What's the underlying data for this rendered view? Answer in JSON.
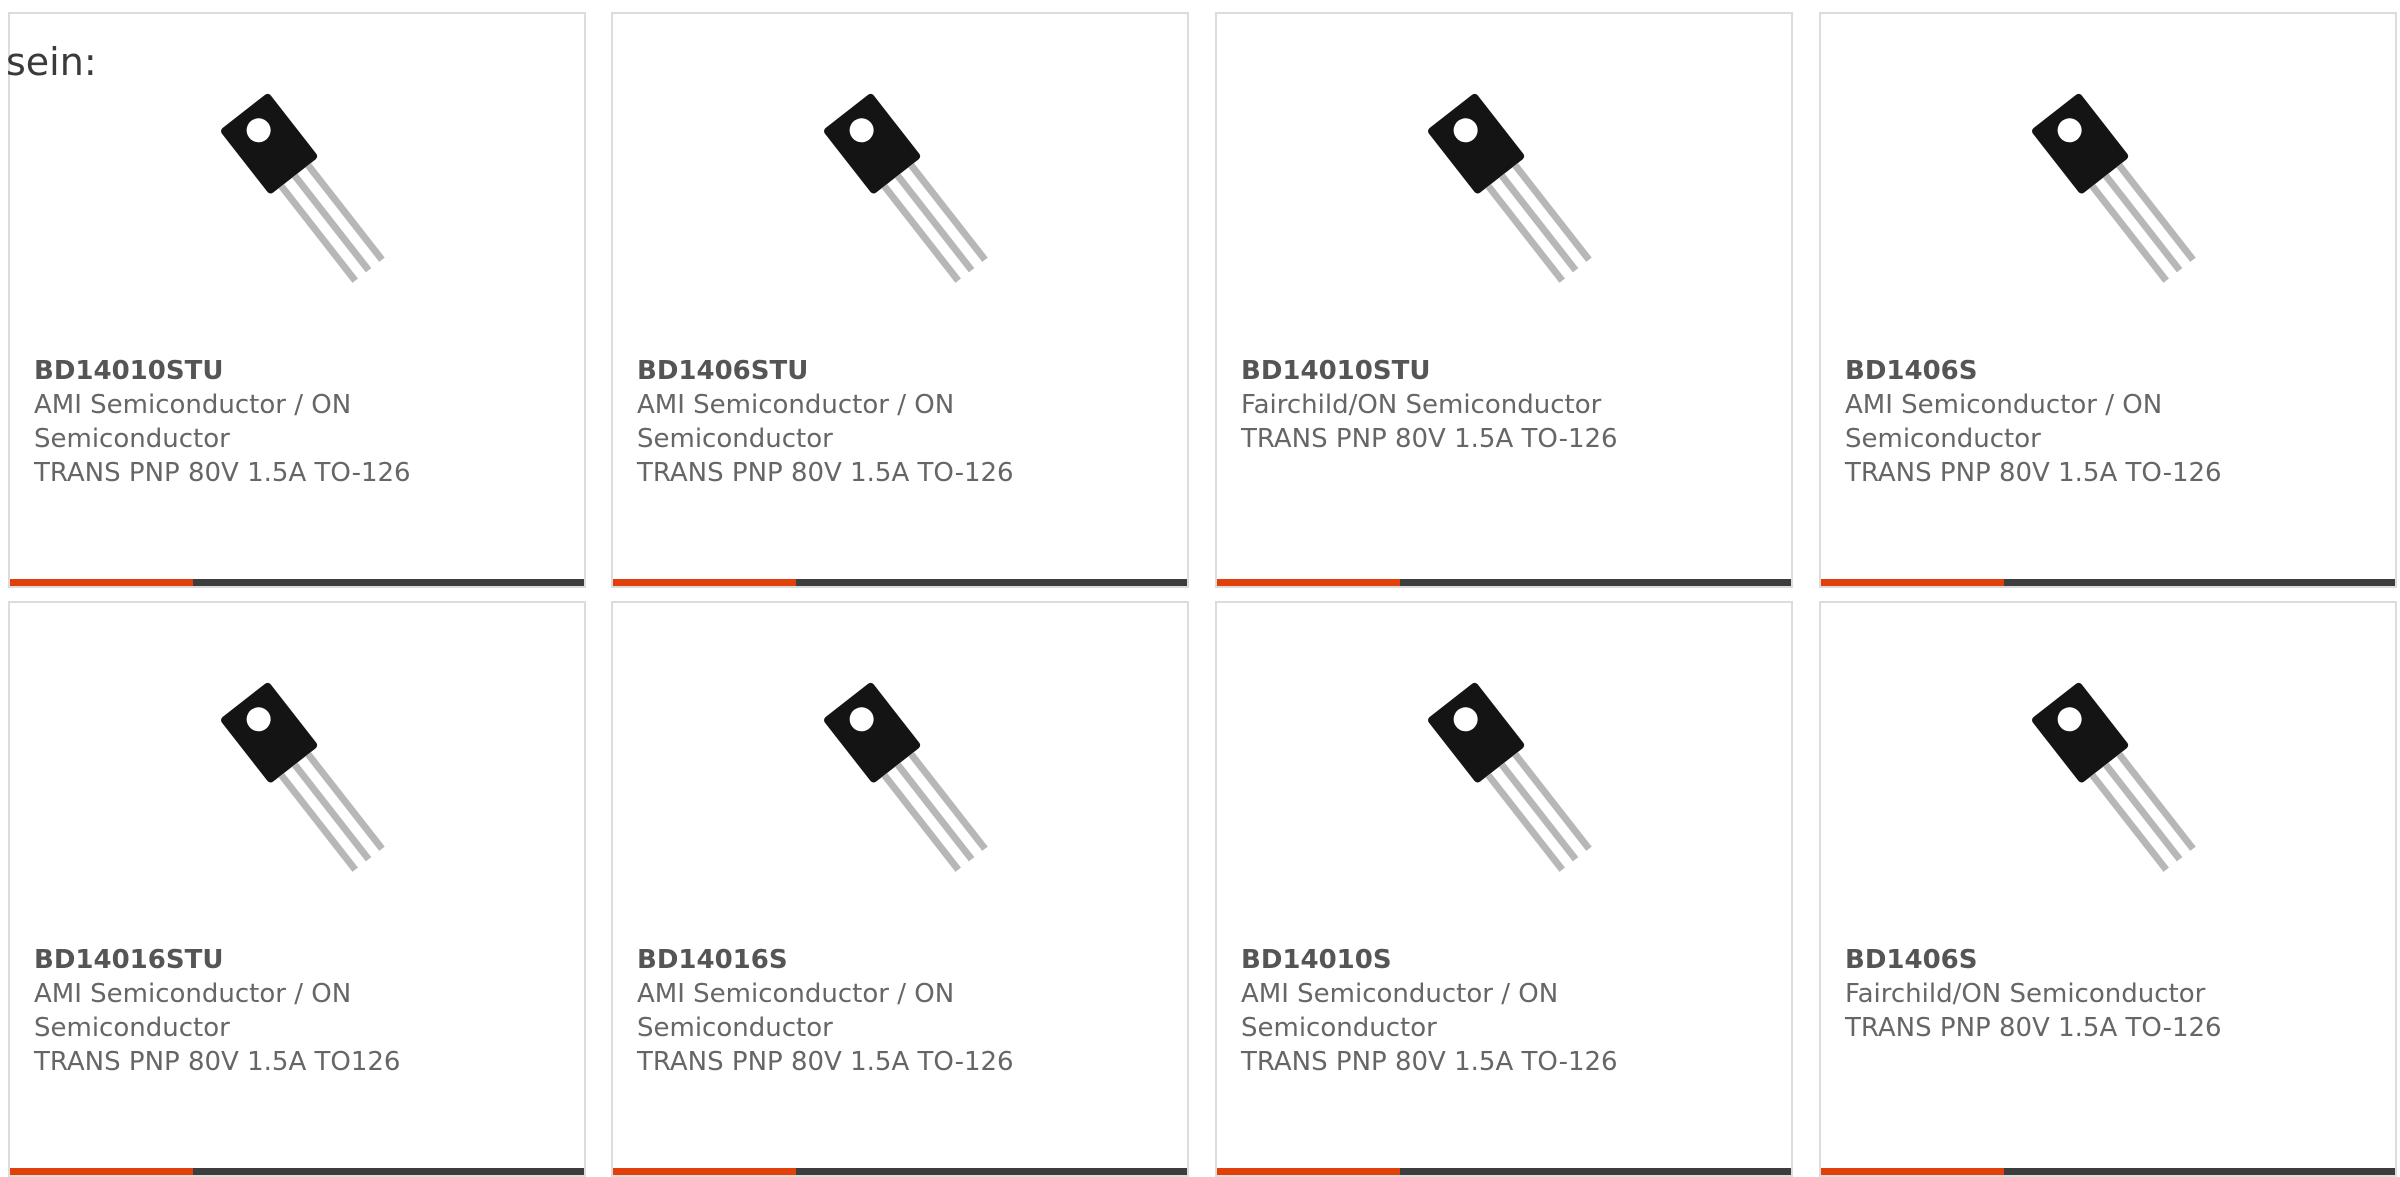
{
  "intro_text": "sein:",
  "accent_color": "#e2400a",
  "bar_color": "#3d3d3d",
  "products": [
    {
      "part_number": "BD14010STU",
      "manufacturer": "AMI Semiconductor / ON Semiconductor",
      "description": "TRANS PNP 80V 1.5A TO-126",
      "image": "transistor-to126-icon"
    },
    {
      "part_number": "BD1406STU",
      "manufacturer": "AMI Semiconductor / ON Semiconductor",
      "description": "TRANS PNP 80V 1.5A TO-126",
      "image": "transistor-to126-icon"
    },
    {
      "part_number": "BD14010STU",
      "manufacturer": "Fairchild/ON Semiconductor",
      "description": "TRANS PNP 80V 1.5A TO-126",
      "image": "transistor-to126-icon"
    },
    {
      "part_number": "BD1406S",
      "manufacturer": "AMI Semiconductor / ON Semiconductor",
      "description": "TRANS PNP 80V 1.5A TO-126",
      "image": "transistor-to126-icon"
    },
    {
      "part_number": "BD14016STU",
      "manufacturer": "AMI Semiconductor / ON Semiconductor",
      "description": "TRANS PNP 80V 1.5A TO126",
      "image": "transistor-to126-icon"
    },
    {
      "part_number": "BD14016S",
      "manufacturer": "AMI Semiconductor / ON Semiconductor",
      "description": "TRANS PNP 80V 1.5A TO-126",
      "image": "transistor-to126-icon"
    },
    {
      "part_number": "BD14010S",
      "manufacturer": "AMI Semiconductor / ON Semiconductor",
      "description": "TRANS PNP 80V 1.5A TO-126",
      "image": "transistor-to126-icon"
    },
    {
      "part_number": "BD1406S",
      "manufacturer": "Fairchild/ON Semiconductor",
      "description": "TRANS PNP 80V 1.5A TO-126",
      "image": "transistor-to126-icon"
    }
  ]
}
